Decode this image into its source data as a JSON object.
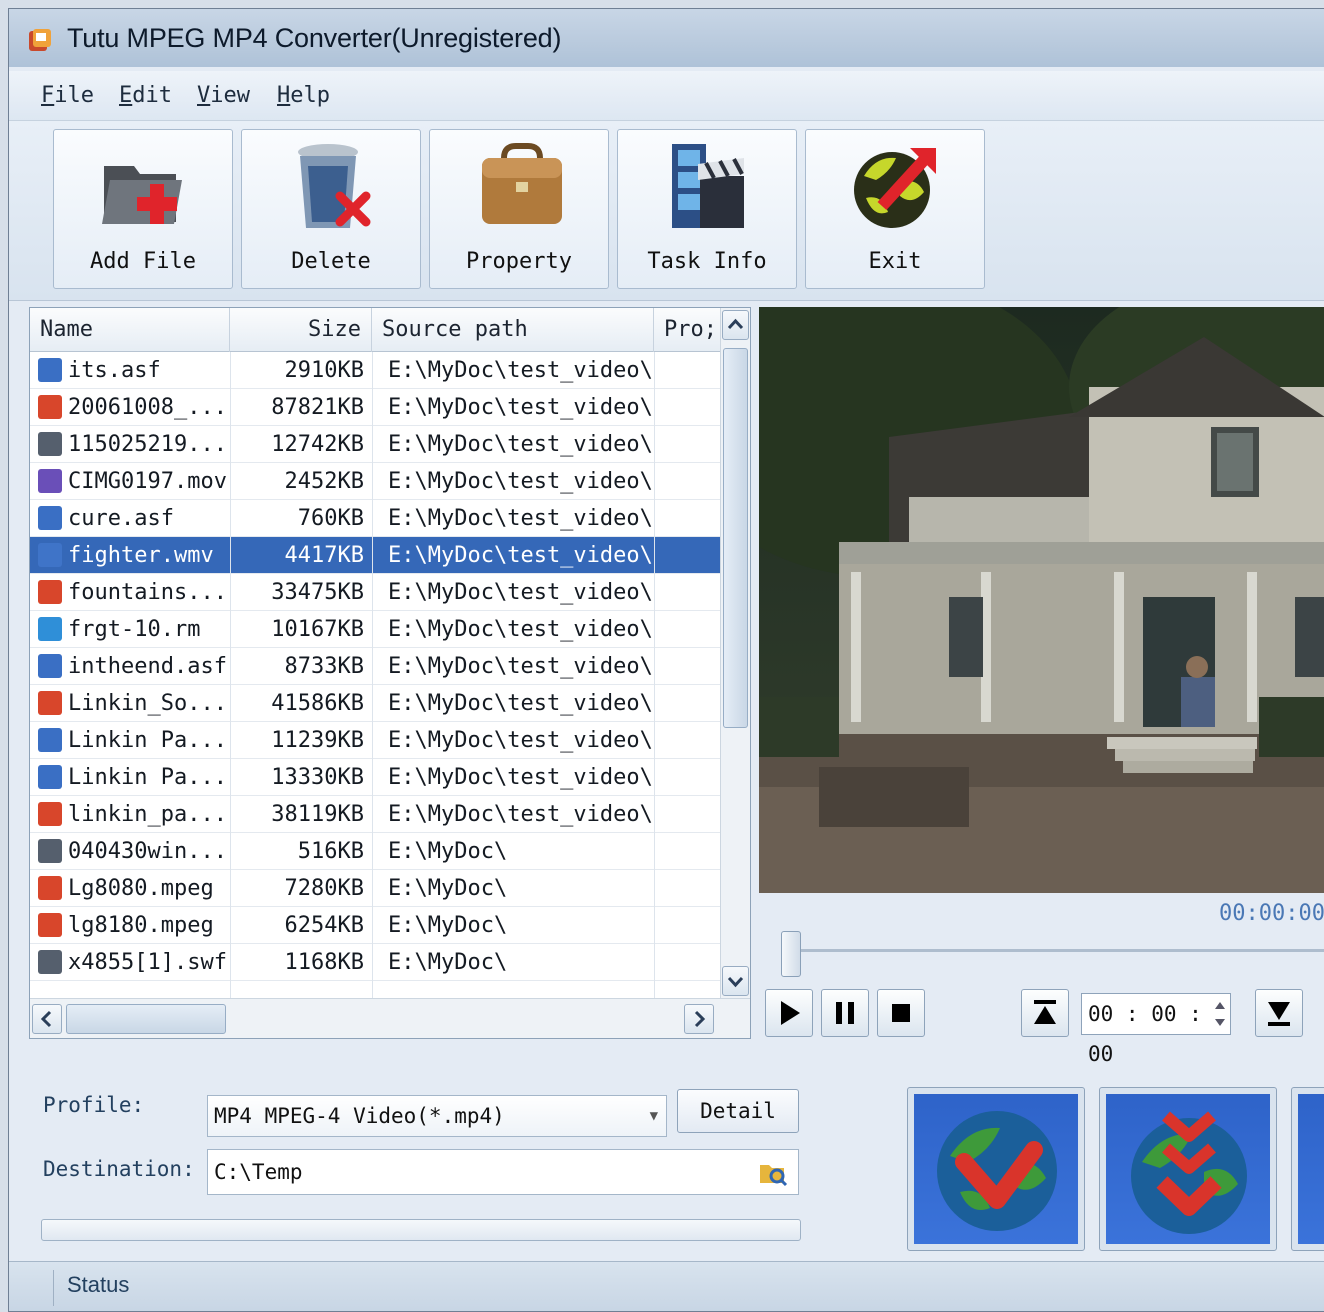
{
  "window": {
    "title": "Tutu MPEG MP4 Converter(Unregistered)"
  },
  "menu": [
    {
      "label": "File",
      "key": "F",
      "rest": "ile"
    },
    {
      "label": "Edit",
      "key": "E",
      "rest": "dit"
    },
    {
      "label": "View",
      "key": "V",
      "rest": "iew"
    },
    {
      "label": "Help",
      "key": "H",
      "rest": "elp"
    }
  ],
  "toolbar": {
    "add_file": "Add File",
    "delete": "Delete",
    "property": "Property",
    "task_info": "Task Info",
    "exit": "Exit"
  },
  "file_list": {
    "columns": {
      "name": "Name",
      "size": "Size",
      "source": "Source path",
      "progress": "Pro;"
    },
    "rows": [
      {
        "name": "its.asf",
        "size": "2910KB",
        "path": "E:\\MyDoc\\test_video\\",
        "icon": "asf"
      },
      {
        "name": "20061008_...",
        "size": "87821KB",
        "path": "E:\\MyDoc\\test_video\\",
        "icon": "mpg"
      },
      {
        "name": "115025219...",
        "size": "12742KB",
        "path": "E:\\MyDoc\\test_video\\",
        "icon": "swf"
      },
      {
        "name": "CIMG0197.mov",
        "size": "2452KB",
        "path": "E:\\MyDoc\\test_video\\",
        "icon": "mov"
      },
      {
        "name": "cure.asf",
        "size": "760KB",
        "path": "E:\\MyDoc\\test_video\\",
        "icon": "asf"
      },
      {
        "name": "fighter.wmv",
        "size": "4417KB",
        "path": "E:\\MyDoc\\test_video\\",
        "icon": "wmv",
        "selected": true
      },
      {
        "name": "fountains...",
        "size": "33475KB",
        "path": "E:\\MyDoc\\test_video\\",
        "icon": "mpg"
      },
      {
        "name": "frgt-10.rm",
        "size": "10167KB",
        "path": "E:\\MyDoc\\test_video\\",
        "icon": "rm"
      },
      {
        "name": "intheend.asf",
        "size": "8733KB",
        "path": "E:\\MyDoc\\test_video\\",
        "icon": "asf"
      },
      {
        "name": "Linkin_So...",
        "size": "41586KB",
        "path": "E:\\MyDoc\\test_video\\",
        "icon": "mpg"
      },
      {
        "name": "Linkin Pa...",
        "size": "11239KB",
        "path": "E:\\MyDoc\\test_video\\",
        "icon": "asf"
      },
      {
        "name": "Linkin Pa...",
        "size": "13330KB",
        "path": "E:\\MyDoc\\test_video\\",
        "icon": "asf"
      },
      {
        "name": "linkin_pa...",
        "size": "38119KB",
        "path": "E:\\MyDoc\\test_video\\",
        "icon": "mpg"
      },
      {
        "name": "040430win...",
        "size": "516KB",
        "path": "E:\\MyDoc\\",
        "icon": "swf"
      },
      {
        "name": "Lg8080.mpeg",
        "size": "7280KB",
        "path": "E:\\MyDoc\\",
        "icon": "mpg"
      },
      {
        "name": "lg8180.mpeg",
        "size": "6254KB",
        "path": "E:\\MyDoc\\",
        "icon": "mpg"
      },
      {
        "name": "x4855[1].swf",
        "size": "1168KB",
        "path": "E:\\MyDoc\\",
        "icon": "swf"
      }
    ]
  },
  "preview": {
    "timestamp": "00:00:00",
    "time_value": "00 : 00 : 00"
  },
  "settings": {
    "profile_label": "Profile:",
    "profile_value": "MP4 MPEG-4 Video(*.mp4)",
    "detail_label": "Detail",
    "destination_label": "Destination:",
    "destination_value": "C:\\Temp"
  },
  "status": {
    "text": "Status"
  },
  "colors": {
    "selection": "#3568b8",
    "accent": "#3b73da"
  }
}
